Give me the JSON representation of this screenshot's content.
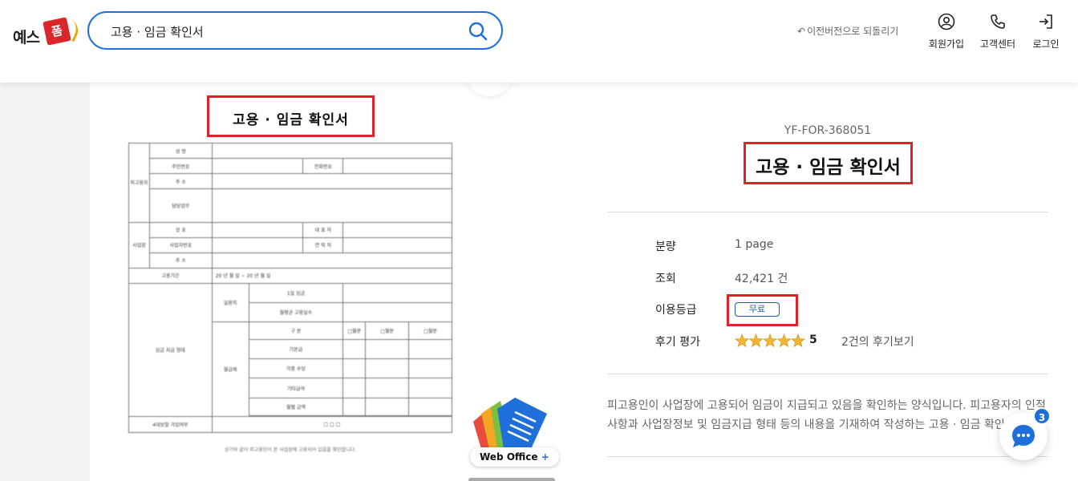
{
  "header": {
    "logo_text": "예스",
    "logo_badge": "폼",
    "search": {
      "value": "고용 · 임금 확인서",
      "placeholder": ""
    },
    "prev_version": "이전버전으로 되돌리기",
    "signup": "회원가입",
    "support": "고객센터",
    "login": "로그인"
  },
  "preview": {
    "title": "고용 · 임금 확인서",
    "rows": {
      "employee": "피고용자",
      "name": "성 명",
      "rrn": "주민번호",
      "phone": "전화번호",
      "address": "주 소",
      "duty": "담당업무",
      "workplace": "사업장",
      "company": "상 호",
      "ceo": "대 표 자",
      "biz_no": "사업자번호",
      "contact": "연 락 처",
      "addr2": "주 소",
      "period": "고용기간",
      "period_value": "20 년 월 일 ~ 20 년 월 일",
      "wage": "임금 지급 형태",
      "daily": "일용직",
      "daily_days": "1일 임금",
      "daily_monthly": "월평균 고용일수",
      "monthly": "월급제",
      "month_col": "구 분",
      "m1": "□월분",
      "m2": "□월분",
      "m3": "□월분",
      "base": "기본급",
      "allowance": "각종 수당",
      "other": "기타급여",
      "total": "월별 금액",
      "insurance": "4대보험 가입여부"
    },
    "footnote": "상기와 같이 피고용인이 본 사업장에 고용되어 있음을 확인합니다."
  },
  "web_office": {
    "label": "Web Office",
    "plus": "+"
  },
  "info": {
    "code": "YF-FOR-368051",
    "title": "고용 · 임금 확인서",
    "volume_label": "분량",
    "volume_value": "1 page",
    "views_label": "조회",
    "views_value": "42,421 건",
    "grade_label": "이용등급",
    "grade_value": "무료",
    "review_label": "후기 평가",
    "rating": 5,
    "rating_text": "5",
    "review_link": "2건의 후기보기",
    "description_1": "피고용인이 사업장에 고용되어 임금이 지급되고 있음을 확인하는 양식입니다. 피고용자의 인적",
    "description_2": "사항과 사업장정보 및 임금지급 형태 등의 내용을 기재하여 작성하는 고용 · 임금 확인서"
  },
  "chat": {
    "count": "3"
  },
  "colors": {
    "accent": "#1e6fd9",
    "highlight": "#e0202a",
    "star": "#f2b632",
    "brand_red": "#d9262c"
  }
}
